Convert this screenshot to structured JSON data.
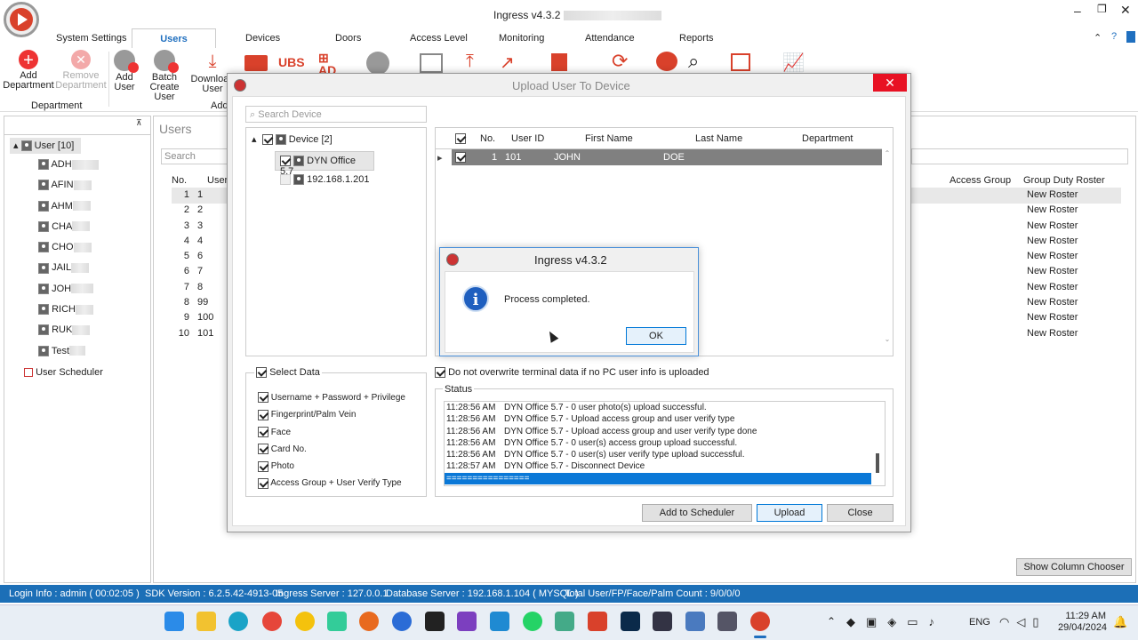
{
  "window": {
    "title": "Ingress v4.3.2"
  },
  "menu": {
    "tabs": [
      "System Settings",
      "Users",
      "Devices",
      "Doors",
      "Access Level",
      "Monitoring",
      "Attendance",
      "Reports"
    ],
    "active": "Users"
  },
  "toolbar": {
    "add_department": "Add\nDepartment",
    "remove_department": "Remove\nDepartment",
    "department_group": "Department",
    "add_user": "Add\nUser",
    "batch_create": "Batch\nCreate User",
    "download": "Download\nUser",
    "add_group": "Add",
    "ubs": "UBS",
    "ad": "AD"
  },
  "left_panel": {
    "root": "User [10]",
    "items": [
      "ADH",
      "AFIN",
      "AHM",
      "CHA",
      "CHO",
      "JAIL",
      "JOH",
      "RICH",
      "RUK",
      "Test"
    ],
    "scheduler": "User Scheduler"
  },
  "users": {
    "title": "Users",
    "search_placeholder": "Search",
    "columns": [
      "No.",
      "User"
    ],
    "rows": [
      [
        "1",
        "1"
      ],
      [
        "2",
        "2"
      ],
      [
        "3",
        "3"
      ],
      [
        "4",
        "4"
      ],
      [
        "5",
        "6"
      ],
      [
        "6",
        "7"
      ],
      [
        "7",
        "8"
      ],
      [
        "8",
        "99"
      ],
      [
        "9",
        "100"
      ],
      [
        "10",
        "101"
      ]
    ],
    "right_columns": [
      "Access Group",
      "Group Duty Roster"
    ],
    "roster": "New Roster",
    "show_column_chooser": "Show Column Chooser"
  },
  "dialog": {
    "title": "Upload User To Device",
    "search_placeholder": "Search Device",
    "device_root": "Device [2]",
    "devices": [
      "DYN Office 5.7",
      "192.168.1.201"
    ],
    "grid_columns": [
      "No.",
      "User ID",
      "First Name",
      "Last Name",
      "Department"
    ],
    "grid_row": [
      "1",
      "101",
      "JOHN",
      "DOE",
      ""
    ],
    "select_data": "Select Data",
    "options": [
      "Username + Password + Privilege",
      "Fingerprint/Palm Vein",
      "Face",
      "Card No.",
      "Photo",
      "Access Group + User Verify Type"
    ],
    "no_overwrite": "Do not overwrite terminal data if no PC user info is uploaded",
    "status_label": "Status",
    "status_lines": [
      [
        "11:28:56 AM",
        "DYN Office 5.7 - 0 user photo(s) upload successful."
      ],
      [
        "11:28:56 AM",
        "DYN Office 5.7 - Upload access group and user verify type"
      ],
      [
        "11:28:56 AM",
        "DYN Office 5.7 - Upload access group and user verify type done"
      ],
      [
        "11:28:56 AM",
        "DYN Office 5.7 - 0 user(s) access group upload successful."
      ],
      [
        "11:28:56 AM",
        "DYN Office 5.7 - 0 user(s) user verify type upload successful."
      ],
      [
        "11:28:57 AM",
        "DYN Office 5.7 - Disconnect Device"
      ]
    ],
    "separator": "================",
    "add_scheduler": "Add to Scheduler",
    "upload": "Upload",
    "close": "Close"
  },
  "msgbox": {
    "title": "Ingress v4.3.2",
    "message": "Process completed.",
    "ok": "OK"
  },
  "statusbar": {
    "login": "Login Info : admin ( 00:02:05 )",
    "sdk": "SDK Version : 6.2.5.42-4913-05",
    "server": "Ingress Server : 127.0.0.1",
    "db": "Database Server : 192.168.1.104 ( MYSQL )",
    "total": "Total User/FP/Face/Palm Count : 9/0/0/0"
  },
  "taskbar": {
    "lang": "ENG",
    "time": "11:29 AM",
    "date": "29/04/2024"
  },
  "colors": {
    "accent": "#1f6fbf",
    "status_bar": "#1c6fb7",
    "select_blue": "#0a78d7",
    "close_red": "#e81123"
  }
}
